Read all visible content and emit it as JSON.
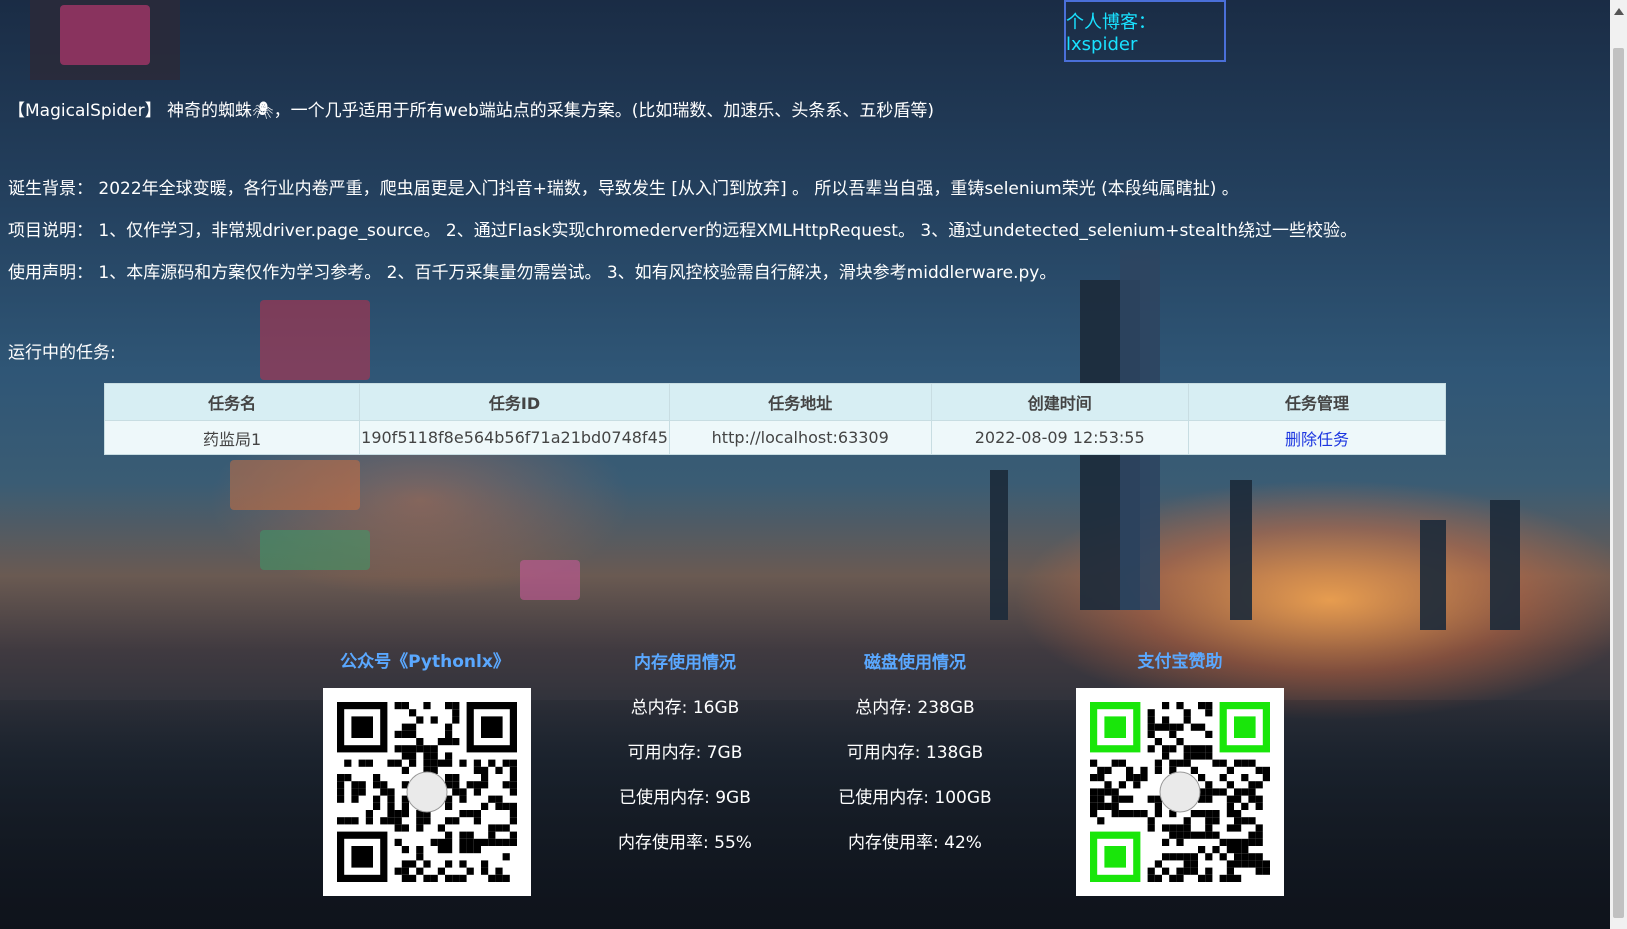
{
  "blog": {
    "label": "个人博客：lxspider"
  },
  "intro": {
    "title": "【MagicalSpider】 神奇的蜘蛛🕷，一个几乎适用于所有web端站点的采集方案。(比如瑞数、加速乐、头条系、五秒盾等)",
    "background": "诞生背景： 2022年全球变暖，各行业内卷严重，爬虫届更是入门抖音+瑞数，导致发生 [从入门到放弃] 。 所以吾辈当自强，重铸selenium荣光 (本段纯属瞎扯) 。",
    "description": "项目说明： 1、仅作学习，非常规driver.page_source。 2、通过Flask实现chromederver的远程XMLHttpRequest。 3、通过undetected_selenium+stealth绕过一些校验。",
    "disclaimer": "使用声明： 1、本库源码和方案仅作为学习参考。 2、百千万采集量勿需尝试。 3、如有风控校验需自行解决，滑块参考middlerware.py。",
    "running_label": "运行中的任务:"
  },
  "table": {
    "headers": [
      "任务名",
      "任务ID",
      "任务地址",
      "创建时间",
      "任务管理"
    ],
    "rows": [
      {
        "name": "药监局1",
        "id": "190f5118f8e564b56f71a21bd0748f45",
        "url": "http://localhost:63309",
        "created": "2022-08-09 12:53:55",
        "action": "删除任务"
      }
    ]
  },
  "wechat": {
    "title": "公众号《Pythonlx》"
  },
  "memory": {
    "title": "内存使用情况",
    "total": "总内存: 16GB",
    "available": "可用内存: 7GB",
    "used": "已使用内存: 9GB",
    "rate": "内存使用率: 55%"
  },
  "disk": {
    "title": "磁盘使用情况",
    "total": "总内存: 238GB",
    "available": "可用内存: 138GB",
    "used": "已使用内存: 100GB",
    "rate": "内存使用率: 42%"
  },
  "alipay": {
    "title": "支付宝赞助"
  },
  "colors": {
    "accent_title": "#5aa8ff",
    "blog_text": "#19e1ff",
    "link": "#1b35e0"
  }
}
